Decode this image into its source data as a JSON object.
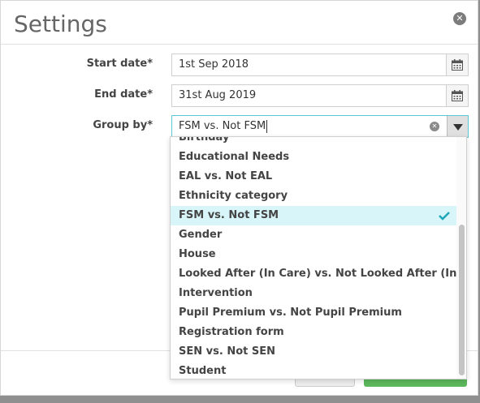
{
  "dialog": {
    "title": "Settings",
    "close_icon": "close-circle-icon"
  },
  "form": {
    "start_date": {
      "label": "Start date*",
      "value": "1st Sep 2018",
      "icon": "calendar-icon"
    },
    "end_date": {
      "label": "End date*",
      "value": "31st Aug 2019",
      "icon": "calendar-icon"
    },
    "group_by": {
      "label": "Group by*",
      "value": "FSM vs. Not FSM",
      "clear_icon": "clear-icon",
      "dropdown_icon": "chevron-down-icon"
    }
  },
  "dropdown": {
    "options": [
      "Birthday",
      "Educational Needs",
      "EAL vs. Not EAL",
      "Ethnicity category",
      "FSM vs. Not FSM",
      "Gender",
      "House",
      "Looked After (In Care) vs. Not Looked After (In Care)",
      "Intervention",
      "Pupil Premium vs. Not Pupil Premium",
      "Registration form",
      "SEN vs. Not SEN",
      "Student"
    ],
    "selected": "FSM vs. Not FSM",
    "check_color": "#1ea5b8"
  },
  "colors": {
    "accent": "#5cc6d2",
    "selected_bg": "#d8f6fa",
    "primary_button": "#5cb85c"
  }
}
